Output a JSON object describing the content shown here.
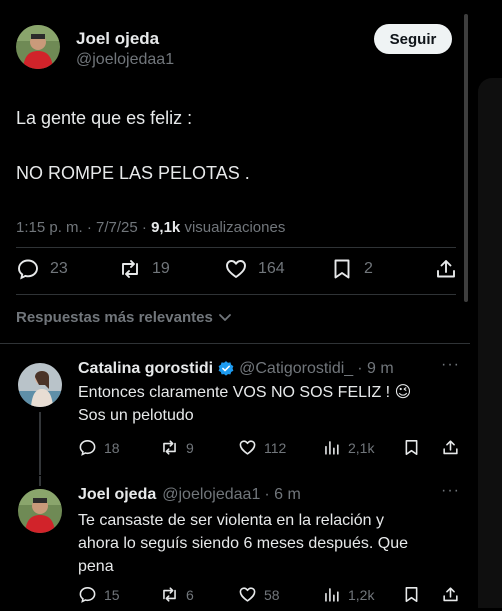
{
  "main_tweet": {
    "author_name": "Joel ojeda",
    "author_handle": "@joelojedaa1",
    "follow_label": "Seguir",
    "line1": "La gente que es feliz :",
    "line2": "NO ROMPE LAS PELOTAS .",
    "time": "1:15 p. m. · 7/7/25 · ",
    "views_count": "9,1k",
    "views_label": " visualizaciones",
    "replies": "23",
    "retweets": "19",
    "likes": "164",
    "bookmarks": "2"
  },
  "sort_label": "Respuestas más relevantes",
  "replies": [
    {
      "name": "Catalina gorostidi",
      "handle": "@Catigorostidi_",
      "time": "· 9 m",
      "line1": "Entonces claramente VOS NO SOS FELIZ ! 😉",
      "line2": "Sos un pelotudo",
      "replies": "18",
      "retweets": "9",
      "likes": "112",
      "views": "2,1k"
    },
    {
      "name": "Joel ojeda",
      "handle": "@joelojedaa1",
      "time": "· 6 m",
      "line1": "Te cansaste de ser violenta en la relación y",
      "line2": "ahora lo seguís siendo 6 meses después. Que",
      "line3": "pena",
      "replies": "15",
      "retweets": "6",
      "likes": "58",
      "views": "1,2k"
    }
  ],
  "colors": {
    "background": "#000000",
    "text": "#e7e9ea",
    "muted": "#71767b",
    "verified": "#1d9bf0"
  }
}
